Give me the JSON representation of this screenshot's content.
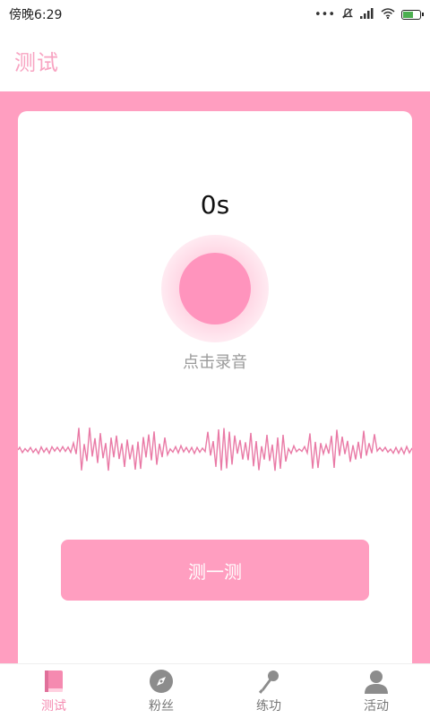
{
  "status_bar": {
    "time": "傍晚6:29",
    "icons": [
      "more-dots-icon",
      "mute-icon",
      "signal-icon",
      "wifi-icon",
      "battery-charging-icon"
    ],
    "battery_level": 0.55
  },
  "header": {
    "title": "测试"
  },
  "recorder": {
    "timer": "0s",
    "hint": "点击录音",
    "action_label": "测一测"
  },
  "tab_bar": {
    "items": [
      {
        "label": "测试",
        "icon": "book-icon",
        "active": true
      },
      {
        "label": "粉丝",
        "icon": "compass-icon",
        "active": false
      },
      {
        "label": "练功",
        "icon": "microphone-icon",
        "active": false
      },
      {
        "label": "活动",
        "icon": "user-icon",
        "active": false
      }
    ]
  },
  "colors": {
    "accent": "#ff9ec0",
    "header_title": "#f8a4c2",
    "active_tab": "#f58ab0",
    "inactive_tab": "#8c8c8c",
    "waveform": "#e97aa6"
  }
}
